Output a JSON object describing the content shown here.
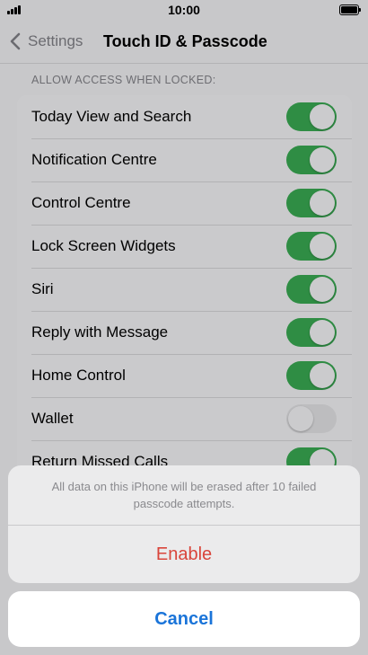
{
  "status_bar": {
    "time": "10:00",
    "signal_icon": "signal-bars-icon",
    "battery_icon": "battery-full-icon"
  },
  "nav": {
    "back_label": "Settings",
    "back_icon": "chevron-left-icon",
    "title": "Touch ID & Passcode"
  },
  "section": {
    "header": "ALLOW ACCESS WHEN LOCKED:",
    "rows": [
      {
        "label": "Today View and Search",
        "on": true
      },
      {
        "label": "Notification Centre",
        "on": true
      },
      {
        "label": "Control Centre",
        "on": true
      },
      {
        "label": "Lock Screen Widgets",
        "on": true
      },
      {
        "label": "Siri",
        "on": true
      },
      {
        "label": "Reply with Message",
        "on": true
      },
      {
        "label": "Home Control",
        "on": true
      },
      {
        "label": "Wallet",
        "on": false
      },
      {
        "label": "Return Missed Calls",
        "on": true
      }
    ]
  },
  "action_sheet": {
    "message": "All data on this iPhone will be erased after 10 failed passcode attempts.",
    "enable_label": "Enable",
    "cancel_label": "Cancel"
  },
  "colors": {
    "toggle_on": "#2f8d44",
    "toggle_off": "#bdbdbf",
    "destructive": "#d9453b",
    "cancel": "#1a74d9"
  }
}
